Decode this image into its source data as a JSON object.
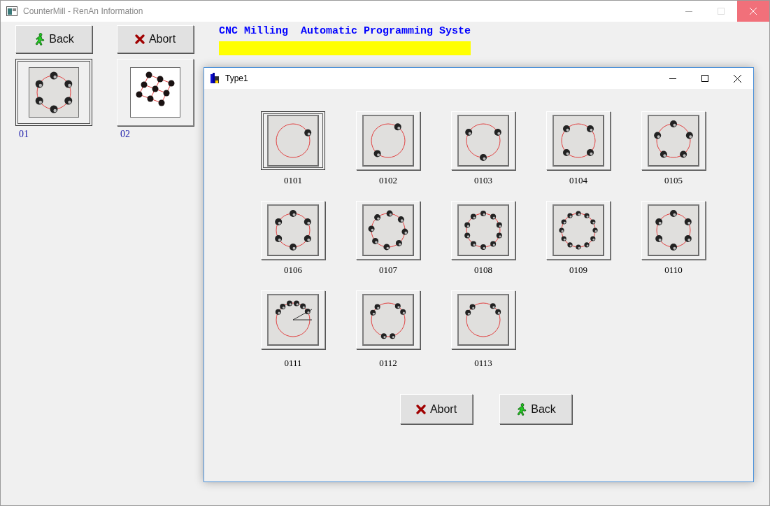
{
  "window": {
    "title": "CounterMill - RenAn Information"
  },
  "toolbar": [
    {
      "kind": "back",
      "label": "Back"
    },
    {
      "kind": "abort",
      "label": "Abort"
    }
  ],
  "header": {
    "title": "CNC Milling  Automatic Programming Syste"
  },
  "categories": [
    {
      "label": "01",
      "selected": true
    },
    {
      "label": "02",
      "selected": false
    }
  ],
  "dialog": {
    "title": "Type1",
    "types": [
      {
        "label": "0101",
        "selected": true
      },
      {
        "label": "0102",
        "selected": false
      },
      {
        "label": "0103",
        "selected": false
      },
      {
        "label": "0104",
        "selected": false
      },
      {
        "label": "0105",
        "selected": false
      },
      {
        "label": "0106",
        "selected": false
      },
      {
        "label": "0107",
        "selected": false
      },
      {
        "label": "0108",
        "selected": false
      },
      {
        "label": "0109",
        "selected": false
      },
      {
        "label": "0110",
        "selected": false
      },
      {
        "label": "0111",
        "selected": false
      },
      {
        "label": "0112",
        "selected": false
      },
      {
        "label": "0113",
        "selected": false
      }
    ],
    "buttons": [
      {
        "kind": "abort",
        "label": "Abort"
      },
      {
        "kind": "back",
        "label": "Back"
      }
    ]
  }
}
